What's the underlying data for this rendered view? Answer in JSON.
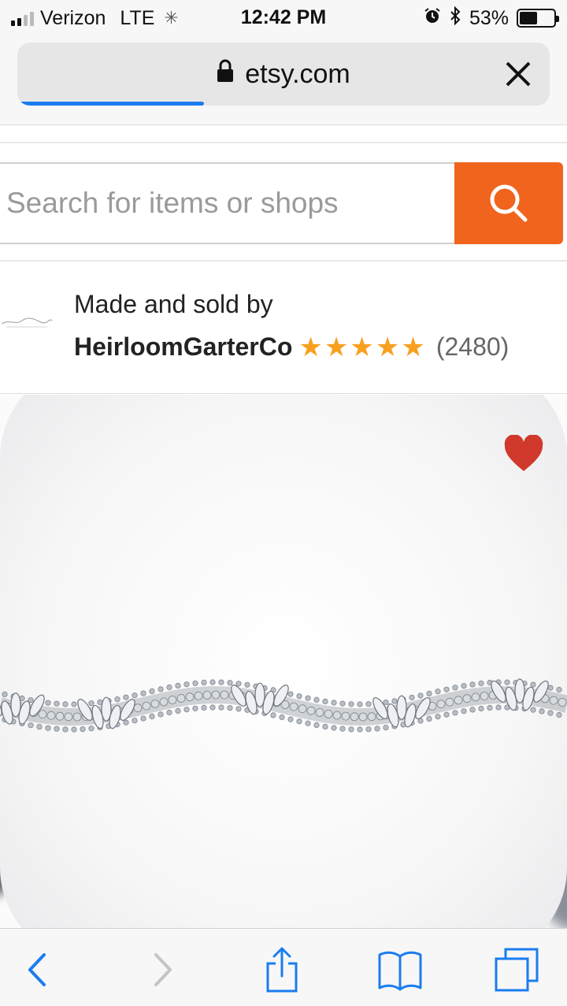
{
  "status_bar": {
    "carrier": "Verizon",
    "network": "LTE",
    "time": "12:42 PM",
    "battery_percent": "53%",
    "battery_level": 0.53
  },
  "browser": {
    "url": "etsy.com",
    "load_progress": 0.35,
    "accent_color": "#1a7cf0"
  },
  "search": {
    "placeholder": "Search for items or shops",
    "button_color": "#f1641e"
  },
  "seller": {
    "made_by_label": "Made and sold by",
    "shop_name": "HeirloomGarterCo",
    "rating": 5,
    "review_count": "(2480)",
    "star_color": "#f8a01e"
  },
  "product": {
    "favorited": true,
    "favorite_color": "#d0392b"
  },
  "toolbar": {
    "icons": [
      "back-icon",
      "forward-icon",
      "share-icon",
      "bookmarks-icon",
      "tabs-icon"
    ],
    "color": "#1a7cf0"
  }
}
